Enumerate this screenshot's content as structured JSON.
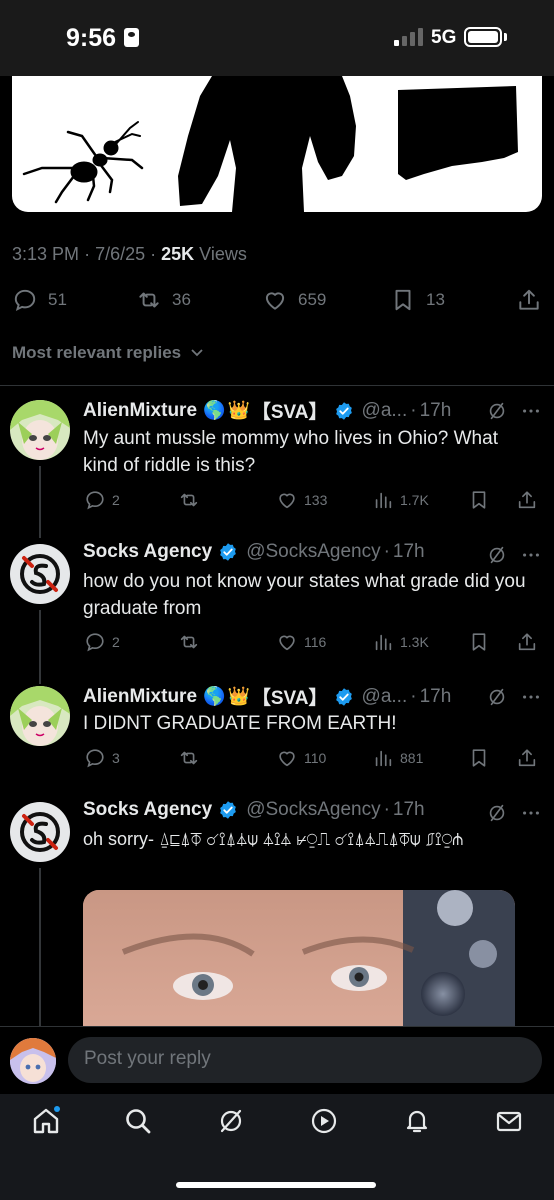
{
  "status_bar": {
    "time": "9:56",
    "network": "5G"
  },
  "post": {
    "time": "3:13 PM",
    "date": "7/6/25",
    "views_count": "25K",
    "views_label": "Views",
    "stats": {
      "replies": "51",
      "reposts": "36",
      "likes": "659",
      "bookmarks": "13"
    }
  },
  "replies_sort": "Most relevant replies",
  "replies": [
    {
      "name": "AlienMixture",
      "tag": "【SVA】",
      "handle": "@a...",
      "time": "17h",
      "text": "My aunt mussle mommy who lives in Ohio? What kind of riddle is this?",
      "replies": "2",
      "likes": "133",
      "views": "1.7K"
    },
    {
      "name": "Socks Agency",
      "handle": "@SocksAgency",
      "time": "17h",
      "text": "how do you not know your states what grade did you graduate from",
      "replies": "2",
      "likes": "116",
      "views": "1.3K"
    },
    {
      "name": "AlienMixture",
      "tag": "【SVA】",
      "handle": "@a...",
      "time": "17h",
      "text": "I DIDNT GRADUATE FROM EARTH!",
      "replies": "3",
      "likes": "110",
      "views": "881"
    },
    {
      "name": "Socks Agency",
      "handle": "@SocksAgency",
      "time": "17h",
      "text": "oh sorry- ⍙⊑⍋⏁ ☌⟟⍋⏃⍦ ⏃⟟⏃ ⊬⍜⎍ ☌⟟⍋⏃⎍⍋⏁⍦ ⎎⟟⍜⋔"
    }
  ],
  "composer": {
    "placeholder": "Post your reply"
  },
  "colors": {
    "background": "#000000",
    "text": "#e7e9ea",
    "muted": "#71767b",
    "accent": "#1d9bf0",
    "divider": "#2f3336"
  }
}
